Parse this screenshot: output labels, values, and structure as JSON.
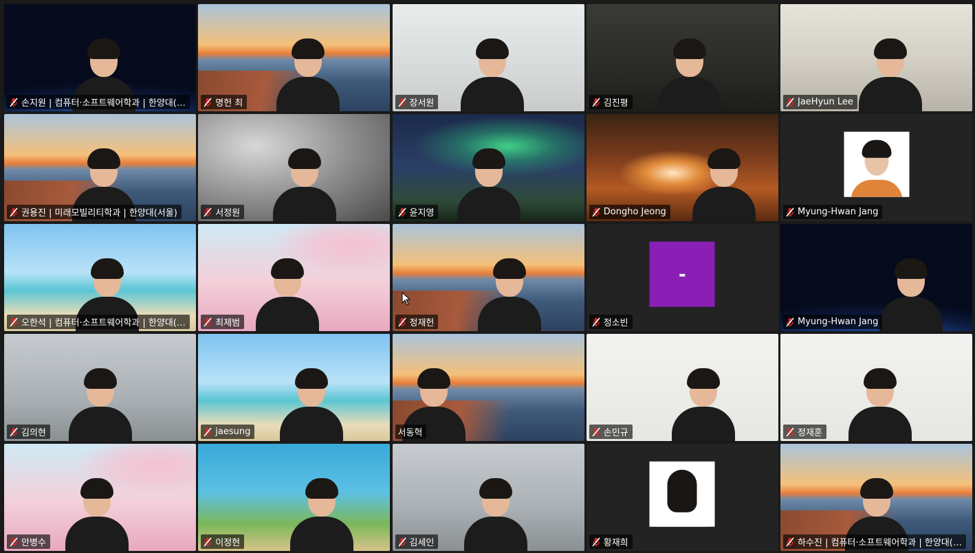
{
  "meeting": {
    "view": "gallery",
    "colors": {
      "background": "#1a1a1a",
      "tile_blank": "#232323",
      "muted_icon": "#e02828",
      "initial_avatar": "#8a1fb5"
    },
    "participants": [
      {
        "name": "손지원 | 컴퓨터·소프트웨어학과 | 한양대(…",
        "muted": true,
        "video": "earth"
      },
      {
        "name": "명헌 최",
        "muted": true,
        "video": "golden-gate"
      },
      {
        "name": "장서원",
        "muted": true,
        "video": "office"
      },
      {
        "name": "김진평",
        "muted": true,
        "video": "dark"
      },
      {
        "name": "JaeHyun Lee",
        "muted": true,
        "video": "room"
      },
      {
        "name": "권용진 | 미래모빌리티학과 | 한양대(서울)",
        "muted": true,
        "video": "golden-gate"
      },
      {
        "name": "서정원",
        "muted": true,
        "video": "blur"
      },
      {
        "name": "윤지영",
        "muted": true,
        "video": "aurora"
      },
      {
        "name": "Dongho Jeong",
        "muted": true,
        "video": "arena"
      },
      {
        "name": "Myung-Hwan Jang",
        "muted": true,
        "video": "off",
        "avatar": "photo"
      },
      {
        "name": "오한석 | 컴퓨터·소프트웨어학과 | 한양대(…",
        "muted": true,
        "video": "beach"
      },
      {
        "name": "최제범",
        "muted": true,
        "video": "blossom"
      },
      {
        "name": "정재헌",
        "muted": true,
        "video": "golden-gate"
      },
      {
        "name": "정소빈",
        "muted": true,
        "video": "off",
        "avatar": "initial",
        "initial": "-"
      },
      {
        "name": "Myung-Hwan Jang",
        "muted": true,
        "video": "earth"
      },
      {
        "name": "김의현",
        "muted": true,
        "video": "grey"
      },
      {
        "name": "jaesung",
        "muted": true,
        "video": "beach"
      },
      {
        "name": "서동혁",
        "muted": false,
        "video": "golden-gate"
      },
      {
        "name": "손민규",
        "muted": true,
        "video": "white"
      },
      {
        "name": "정재훈",
        "muted": true,
        "video": "white"
      },
      {
        "name": "안병수",
        "muted": true,
        "video": "blossom"
      },
      {
        "name": "이정현",
        "muted": true,
        "video": "sponge"
      },
      {
        "name": "김세인",
        "muted": true,
        "video": "grey"
      },
      {
        "name": "황재희",
        "muted": true,
        "video": "off",
        "avatar": "photo-female"
      },
      {
        "name": "하수진 | 컴퓨터·소프트웨어학과 | 한양대(…",
        "muted": true,
        "video": "golden-gate"
      }
    ]
  }
}
